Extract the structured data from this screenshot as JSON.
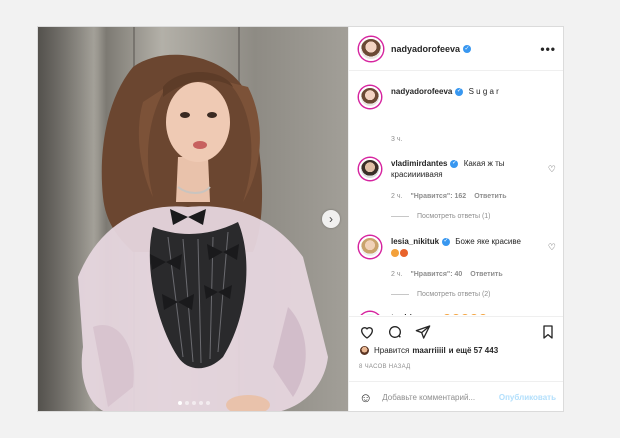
{
  "post": {
    "username": "nadyadorofeeva",
    "caption": "S u g a r",
    "caption_time": "3 ч.",
    "more_icon": "more-options-icon"
  },
  "comments": [
    {
      "username": "vladimirdantes",
      "text": "Какая ж ты красииииваяя",
      "time": "2 ч.",
      "likes": "\"Нравится\": 162",
      "reply": "Ответить",
      "view_replies": "Посмотреть ответы (1)"
    },
    {
      "username": "lesia_nikituk",
      "text": "Боже яке красиве",
      "time": "2 ч.",
      "likes": "\"Нравится\": 40",
      "reply": "Ответить",
      "view_replies": "Посмотреть ответы (2)"
    },
    {
      "username": "trodriguezzz",
      "text": ""
    }
  ],
  "likes": {
    "prefix": "Нравится",
    "user": "maarriiiil",
    "suffix": "и ещё 57 443"
  },
  "time_ago": "8 часов назад",
  "comment_box": {
    "placeholder": "Добавьте комментарий...",
    "post_label": "Опубликовать"
  },
  "colors": {
    "verified": "#3897f0",
    "story_ring": "#d6249f",
    "post_disabled": "#b2dffc"
  }
}
